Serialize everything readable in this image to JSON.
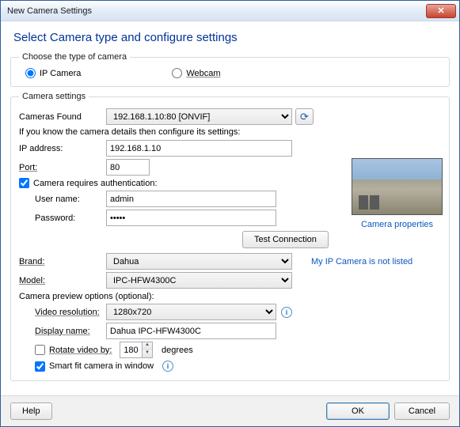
{
  "window": {
    "title": "New Camera Settings"
  },
  "heading": "Select Camera type and configure settings",
  "type_group": {
    "legend": "Choose the type of camera",
    "ip": "IP Camera",
    "webcam": "Webcam"
  },
  "settings": {
    "legend": "Camera settings",
    "cameras_found_label": "Cameras Found",
    "cameras_found_value": "192.168.1.10:80 [ONVIF]",
    "hint": "If you know the camera details then configure its settings:",
    "ip_label": "IP address:",
    "ip_value": "192.168.1.10",
    "port_label": "Port:",
    "port_value": "80",
    "auth_label": "Camera requires authentication:",
    "user_label": "User name:",
    "user_value": "admin",
    "pass_label": "Password:",
    "pass_value": "•••••",
    "test_btn": "Test Connection",
    "brand_label": "Brand:",
    "brand_value": "Dahua",
    "model_label": "Model:",
    "model_value": "IPC-HFW4300C",
    "not_listed": "My IP Camera is not listed",
    "preview_link": "Camera properties",
    "preview_section": "Camera preview options (optional):",
    "res_label": "Video resolution:",
    "res_value": "1280x720",
    "disp_label": "Display name:",
    "disp_value": "Dahua IPC-HFW4300C",
    "rotate_label": "Rotate video by:",
    "rotate_value": "180",
    "rotate_suffix": "degrees",
    "smartfit_label": "Smart fit camera in window"
  },
  "footer": {
    "help": "Help",
    "ok": "OK",
    "cancel": "Cancel"
  }
}
